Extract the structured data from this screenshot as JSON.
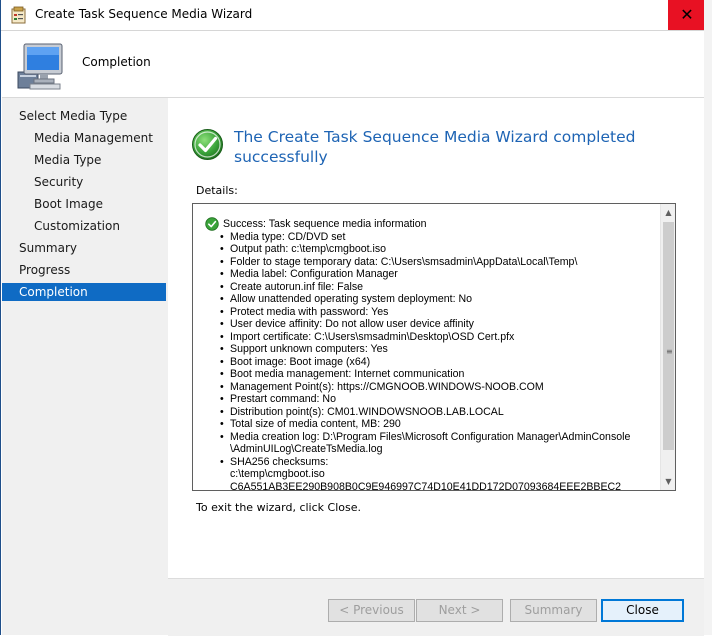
{
  "window": {
    "title": "Create Task Sequence Media Wizard",
    "close_glyph": "✕"
  },
  "header": {
    "title": "Completion",
    "icon": "computer-icon"
  },
  "sidebar": {
    "items": [
      {
        "label": "Select Media Type",
        "indent": 0,
        "selected": false
      },
      {
        "label": "Media Management",
        "indent": 1,
        "selected": false
      },
      {
        "label": "Media Type",
        "indent": 1,
        "selected": false
      },
      {
        "label": "Security",
        "indent": 1,
        "selected": false
      },
      {
        "label": "Boot Image",
        "indent": 1,
        "selected": false
      },
      {
        "label": "Customization",
        "indent": 1,
        "selected": false
      },
      {
        "label": "Summary",
        "indent": 0,
        "selected": false
      },
      {
        "label": "Progress",
        "indent": 0,
        "selected": false
      },
      {
        "label": "Completion",
        "indent": 0,
        "selected": true
      }
    ]
  },
  "main": {
    "heading_line1": "The Create Task Sequence Media Wizard completed",
    "heading_line2": "successfully",
    "details_label": "Details:",
    "success_text": "Success: Task sequence media information",
    "details": [
      [
        "Media type: CD/DVD set"
      ],
      [
        "Output path: c:\\temp\\cmgboot.iso"
      ],
      [
        "Folder to stage temporary data: C:\\Users\\smsadmin\\AppData\\Local\\Temp\\"
      ],
      [
        "Media label: Configuration Manager"
      ],
      [
        "Create autorun.inf file: False"
      ],
      [
        "Allow unattended operating system deployment: No"
      ],
      [
        "Protect media with password: Yes"
      ],
      [
        "User device affinity: Do not allow user device affinity"
      ],
      [
        "Import certificate: C:\\Users\\smsadmin\\Desktop\\OSD Cert.pfx"
      ],
      [
        "Support unknown computers: Yes"
      ],
      [
        "Boot image: Boot image (x64)"
      ],
      [
        "Boot media management: Internet communication"
      ],
      [
        "Management Point(s): https://CMGNOOB.WINDOWS-NOOB.COM"
      ],
      [
        "Prestart command: No"
      ],
      [
        "Distribution point(s): CM01.WINDOWSNOOB.LAB.LOCAL"
      ],
      [
        "Total size of media content, MB:  290"
      ],
      [
        "Media creation log: D:\\Program Files\\Microsoft Configuration Manager\\AdminConsole",
        "\\AdminUILog\\CreateTsMedia.log"
      ],
      [
        "SHA256 checksums:",
        "c:\\temp\\cmgboot.iso",
        "C6A551AB3EE290B908B0C9E946997C74D10E41DD172D07093684EEE2BBEC2"
      ]
    ],
    "exit_text": "To exit the wizard, click Close."
  },
  "buttons": {
    "previous": "< Previous",
    "next": "Next >",
    "summary": "Summary",
    "close": "Close"
  },
  "colors": {
    "accent": "#0f6bc4",
    "heading": "#1e64b4",
    "close_red": "#e81123"
  }
}
